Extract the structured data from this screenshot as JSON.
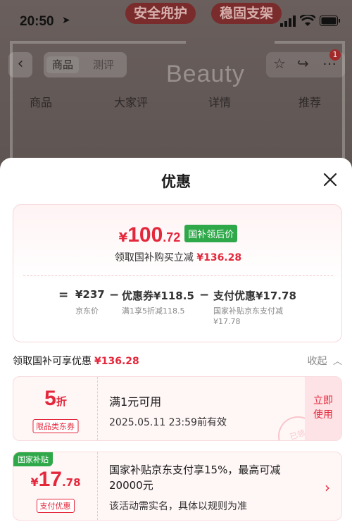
{
  "background": {
    "promo_left": "安全兜护",
    "promo_right": "稳固支架",
    "status_time": "20:50",
    "nav_tabs": [
      "商品",
      "测评"
    ],
    "brand_watermark": "Beauty",
    "badge_count": "1",
    "sub_tabs": [
      "商品",
      "大家评",
      "详情",
      "推荐"
    ]
  },
  "sheet": {
    "title": "优惠",
    "summary": {
      "currency": "¥",
      "price_int": "100",
      "price_dec": ".72",
      "price_tag": "国补领后价",
      "sub_label": "领取国补购买立减",
      "sub_amount": "¥136.28",
      "formula": {
        "eq": "=",
        "jd_price": "¥237",
        "jd_price_label": "京东价",
        "minus1": "−",
        "coupon_value": "优惠券¥118.5",
        "coupon_label": "满1享5折减118.5",
        "minus2": "−",
        "pay_value": "支付优惠¥17.78",
        "pay_label_1": "国家补贴京东支付减",
        "pay_label_2": "¥17.78"
      }
    },
    "section": {
      "title": "领取国补可享优惠",
      "amount": "¥136.28",
      "collapse": "收起"
    },
    "coupons": [
      {
        "big_num": "5",
        "big_unit": "折",
        "label": "限品类东券",
        "line1": "满1元可用",
        "line2": "2025.05.11 23:59前有效",
        "button_1": "立即",
        "button_2": "使用",
        "stamp": "已领"
      },
      {
        "tag": "国家补贴",
        "currency": "¥",
        "big_num": "17",
        "big_dec": ".78",
        "label": "支付优惠",
        "line1a": "国家补贴京东支付享15%，最高可减",
        "line1b": "20000元",
        "line2": "该活动需实名，具体以规则为准"
      }
    ]
  }
}
